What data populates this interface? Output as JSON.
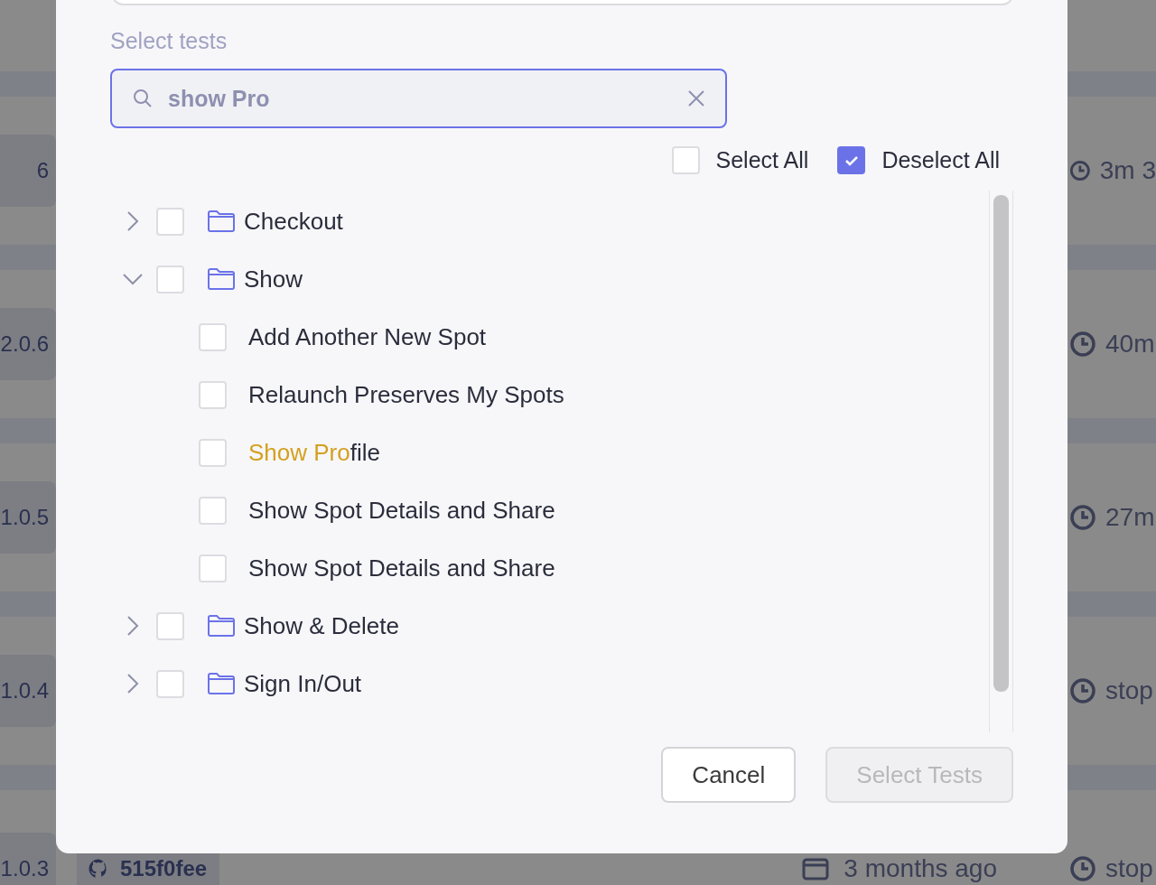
{
  "background_rows": [
    {
      "version": "6",
      "duration": "3m 3"
    },
    {
      "version": "2.0.6",
      "duration": "40m"
    },
    {
      "version": "1.0.5",
      "duration": "27m"
    },
    {
      "version": "1.0.4",
      "duration": "stop"
    },
    {
      "version": "1.0.3",
      "commit": "515f0fee",
      "date": "3 months ago",
      "duration": "stop"
    }
  ],
  "dialog": {
    "label": "Select tests",
    "search": {
      "value": "show Pro"
    },
    "select_all": {
      "label": "Select All",
      "checked": false
    },
    "deselect_all": {
      "label": "Deselect All",
      "checked": true
    },
    "tree": [
      {
        "label": "Checkout",
        "expanded": false,
        "checked": false
      },
      {
        "label": "Show",
        "expanded": true,
        "checked": false,
        "children": [
          {
            "label": "Add Another New Spot",
            "checked": false
          },
          {
            "label": "Relaunch Preserves My Spots",
            "checked": false
          },
          {
            "match": "Show Pro",
            "label": "file",
            "checked": false
          },
          {
            "label": "Show Spot Details and Share",
            "checked": false
          },
          {
            "label": "Show Spot Details and Share",
            "checked": false
          }
        ]
      },
      {
        "label": "Show & Delete",
        "expanded": false,
        "checked": false
      },
      {
        "label": "Sign In/Out",
        "expanded": false,
        "checked": false
      }
    ],
    "buttons": [
      {
        "label": "Cancel",
        "disabled": false
      },
      {
        "label": "Select Tests",
        "disabled": true
      }
    ]
  }
}
